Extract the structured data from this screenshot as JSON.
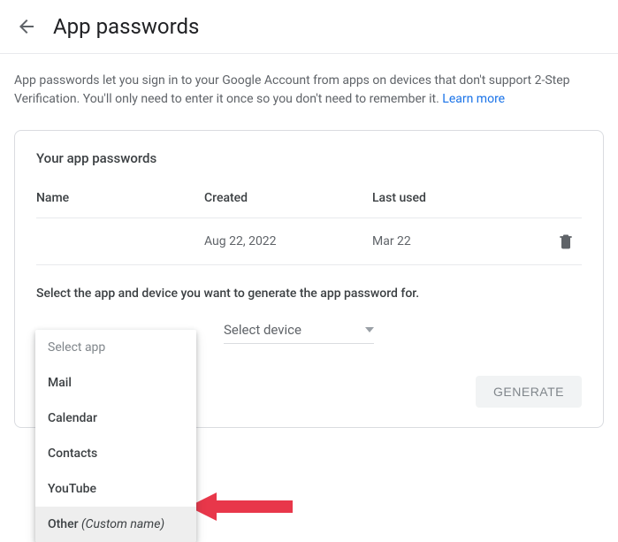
{
  "header": {
    "title": "App passwords"
  },
  "intro": {
    "text": "App passwords let you sign in to your Google Account from apps on devices that don't support 2-Step Verification. You'll only need to enter it once so you don't need to remember it. ",
    "learn_more": "Learn more"
  },
  "card": {
    "title": "Your app passwords",
    "columns": {
      "name": "Name",
      "created": "Created",
      "last_used": "Last used"
    },
    "rows": [
      {
        "name": "",
        "created": "Aug 22, 2022",
        "last_used": "Mar 22"
      }
    ],
    "select_text": "Select the app and device you want to generate the app password for.",
    "select_device_label": "Select device",
    "generate_label": "GENERATE"
  },
  "dropdown": {
    "placeholder": "Select app",
    "items": [
      {
        "label": "Mail"
      },
      {
        "label": "Calendar"
      },
      {
        "label": "Contacts"
      },
      {
        "label": "YouTube"
      },
      {
        "label": "Other",
        "italic_suffix": "(Custom name)",
        "highlight": true
      }
    ]
  }
}
